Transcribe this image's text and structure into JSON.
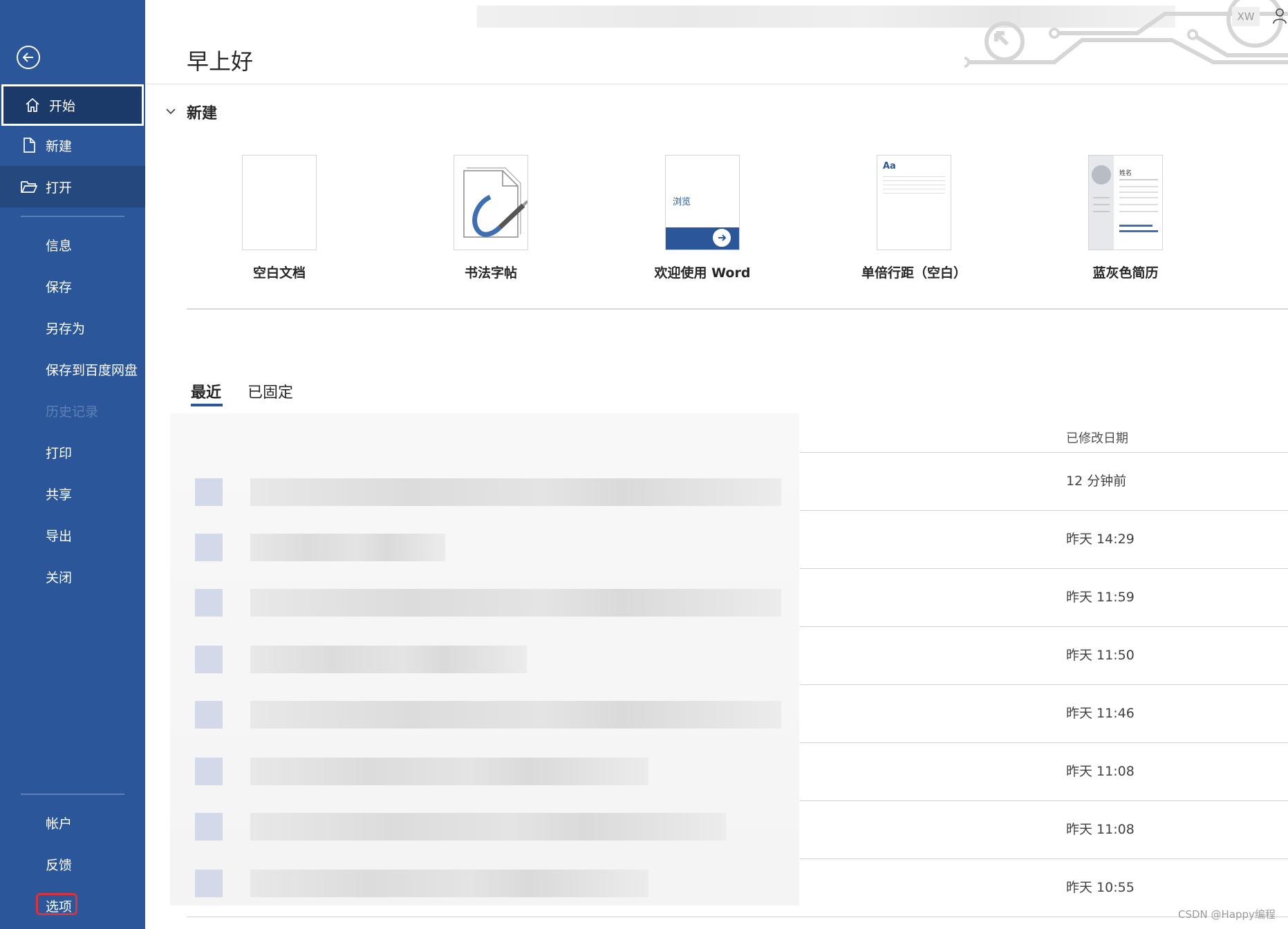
{
  "sidebar": {
    "items": [
      {
        "label": "开始",
        "icon": "home-icon"
      },
      {
        "label": "新建",
        "icon": "new-document-icon"
      },
      {
        "label": "打开",
        "icon": "open-folder-icon"
      },
      {
        "label": "信息"
      },
      {
        "label": "保存"
      },
      {
        "label": "另存为"
      },
      {
        "label": "保存到百度网盘"
      },
      {
        "label": "历史记录"
      },
      {
        "label": "打印"
      },
      {
        "label": "共享"
      },
      {
        "label": "导出"
      },
      {
        "label": "关闭"
      },
      {
        "label": "帐户"
      },
      {
        "label": "反馈"
      },
      {
        "label": "选项"
      }
    ]
  },
  "header": {
    "greeting": "早上好",
    "user_initials": "XW"
  },
  "new_section": {
    "title": "新建",
    "templates": [
      {
        "label": "空白文档"
      },
      {
        "label": "书法字帖"
      },
      {
        "label": "欢迎使用 Word",
        "thumb_text": "浏览"
      },
      {
        "label": "单倍行距（空白）",
        "thumb_text": "Aa"
      },
      {
        "label": "蓝灰色简历",
        "thumb_text": "姓名"
      }
    ]
  },
  "recent": {
    "tabs": [
      {
        "label": "最近",
        "active": true
      },
      {
        "label": "已固定",
        "active": false
      }
    ],
    "date_column_header": "已修改日期",
    "rows": [
      {
        "date": "12 分钟前"
      },
      {
        "date": "昨天 14:29"
      },
      {
        "date": "昨天 11:59"
      },
      {
        "date": "昨天 11:50"
      },
      {
        "date": "昨天 11:46"
      },
      {
        "date": "昨天 11:08"
      },
      {
        "date": "昨天 11:08"
      },
      {
        "date": "昨天 10:55"
      }
    ]
  },
  "watermark": "CSDN @Happy编程",
  "colors": {
    "sidebar": "#2b579a",
    "selected": "#1b3a6a",
    "highlight": "#e0303a"
  }
}
